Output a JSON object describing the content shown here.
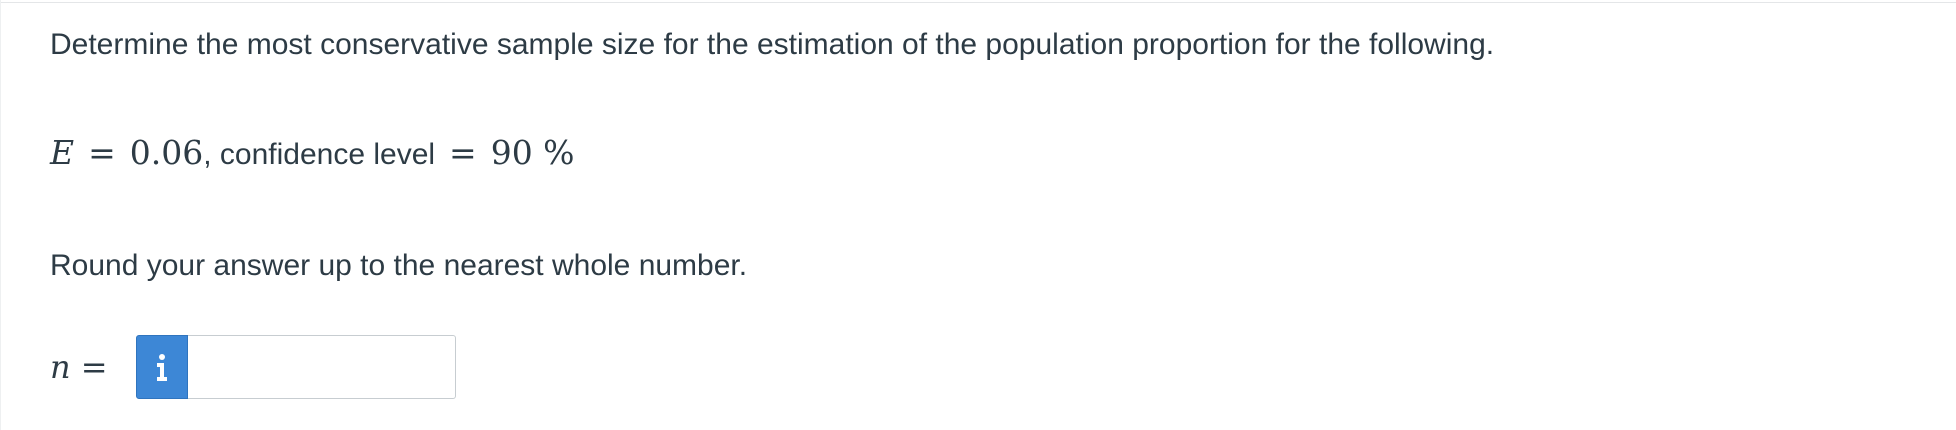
{
  "question": {
    "prompt": "Determine the most conservative sample size for the estimation of the population proportion for the following.",
    "given": {
      "error_symbol": "E",
      "equals": "=",
      "error_value": "0.06",
      "separator_text": ", confidence level",
      "confidence_equals": "=",
      "confidence_value": "90 %"
    },
    "instruction": "Round your answer up to the nearest whole number.",
    "answer": {
      "symbol": "n",
      "equals": "=",
      "info_icon": "info-icon",
      "input_value": "",
      "input_placeholder": ""
    }
  },
  "colors": {
    "text": "#2d3b45",
    "info_button": "#3d87d6",
    "input_border": "#c7cdd1"
  }
}
